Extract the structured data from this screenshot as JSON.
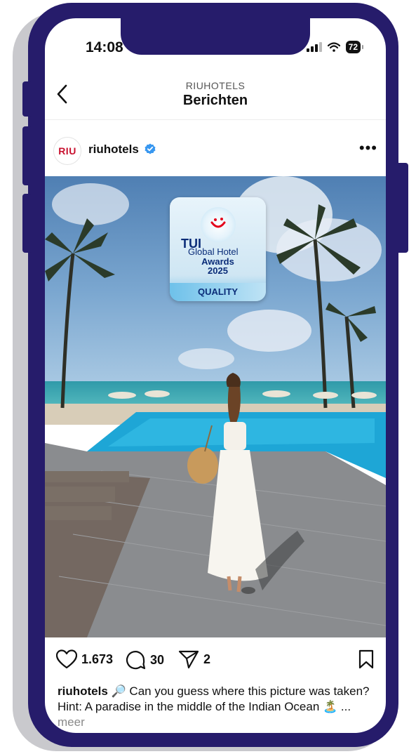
{
  "status_bar": {
    "time": "14:08",
    "battery": "72"
  },
  "header": {
    "account": "RIUHOTELS",
    "title": "Berichten"
  },
  "post": {
    "avatar_text": "RIU",
    "username": "riuhotels",
    "verified": true,
    "image": {
      "badge": {
        "brand": "TUI",
        "line1": "Global Hotel",
        "line2": "Awards",
        "line3": "2025",
        "ribbon": "QUALITY"
      }
    },
    "likes": "1.673",
    "comments": "30",
    "shares": "2",
    "caption_user": "riuhotels",
    "caption_text": "🔎 Can you guess where this picture was taken? Hint: A paradise in the middle of the Indian Ocean 🏝️",
    "caption_ellipsis": "...",
    "more_label": "meer"
  },
  "colors": {
    "phone_frame": "#261c6b",
    "brand_red": "#c8102e",
    "verified_blue": "#3897f0"
  }
}
